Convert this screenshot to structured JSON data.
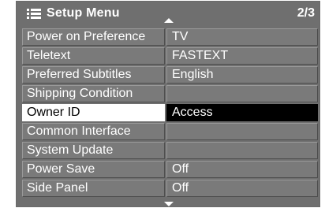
{
  "header": {
    "title": "Setup Menu",
    "page_indicator": "2/3",
    "icon": "list-menu-icon"
  },
  "menu": {
    "items": [
      {
        "label": "Power on Preference",
        "value": "TV",
        "selected": false
      },
      {
        "label": "Teletext",
        "value": "FASTEXT",
        "selected": false
      },
      {
        "label": "Preferred Subtitles",
        "value": "English",
        "selected": false
      },
      {
        "label": "Shipping Condition",
        "value": "",
        "selected": false
      },
      {
        "label": "Owner ID",
        "value": "Access",
        "selected": true
      },
      {
        "label": "Common Interface",
        "value": "",
        "selected": false
      },
      {
        "label": "System Update",
        "value": "",
        "selected": false
      },
      {
        "label": "Power Save",
        "value": "Off",
        "selected": false
      },
      {
        "label": "Side Panel",
        "value": "Off",
        "selected": false
      }
    ]
  },
  "colors": {
    "panel": "#6f6f6f",
    "row": "#7a7a7a",
    "selected_label_bg": "#ffffff",
    "selected_value_bg": "#000000",
    "text": "#ffffff"
  }
}
